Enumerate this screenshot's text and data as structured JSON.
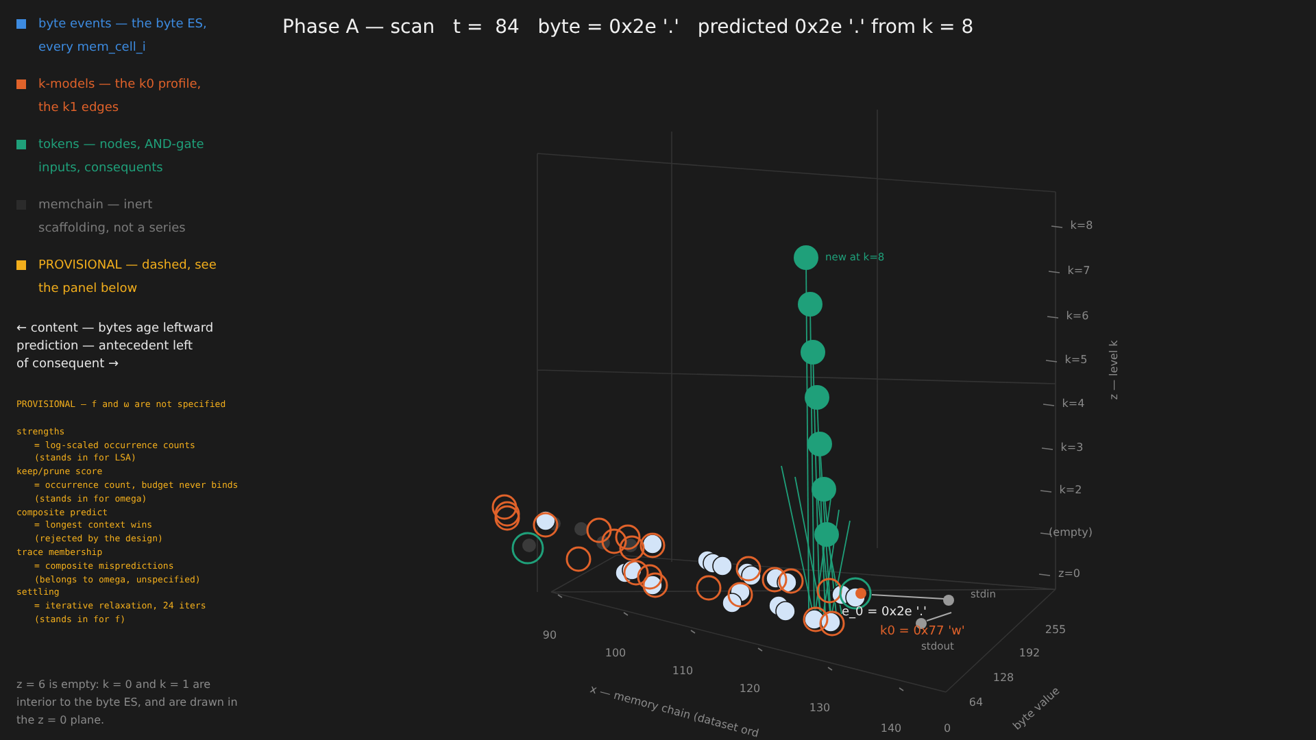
{
  "legend": [
    {
      "label": "byte events — the byte ES, every mem_cell_i",
      "color": "#3d8be0"
    },
    {
      "label": "k-models — the k0 profile, the k1 edges",
      "color": "#e0622a"
    },
    {
      "label": "tokens — nodes, AND-gate inputs, consequents",
      "color": "#1fa07a"
    },
    {
      "label": "memchain — inert scaffolding, not a series",
      "color": "#2b2b2b"
    },
    {
      "label": "PROVISIONAL — dashed, see the panel below",
      "color": "#f2ae1c"
    }
  ],
  "direction_note": "←  content — bytes age leftward\nprediction — antecedent left\nof consequent  →",
  "provisional_panel": {
    "title": "PROVISIONAL — f and ω are not specified",
    "entries": [
      {
        "term": "strengths",
        "definition": "= log-scaled occurrence counts",
        "note": "(stands in for LSA)"
      },
      {
        "term": "keep/prune score",
        "definition": "= occurrence count, budget never binds",
        "note": "(stands in for omega)"
      },
      {
        "term": "composite predict",
        "definition": "= longest context wins",
        "note": "(rejected by the design)"
      },
      {
        "term": "trace membership",
        "definition": "= composite mispredictions",
        "note": "(belongs to omega, unspecified)"
      },
      {
        "term": "settling",
        "definition": "= iterative relaxation, 24 iters",
        "note": "(stands in for f)"
      }
    ]
  },
  "footnote": "z = 6 is empty: k = 0 and k = 1 are interior to the byte ES, and are drawn in the z = 0 plane.",
  "title": "Phase A — scan   t =  84   byte = 0x2e '.'   predicted 0x2e '.' from k = 8",
  "plot": {
    "z_axis": {
      "title": "z — level k",
      "ticks": [
        "k=8",
        "k=7",
        "k=6",
        "k=5",
        "k=4",
        "k=3",
        "k=2",
        "(empty)",
        "z=0"
      ]
    },
    "x_axis": {
      "title": "x — memory chain (dataset ord",
      "ticks": [
        "90",
        "100",
        "110",
        "120",
        "130",
        "140"
      ]
    },
    "y_axis": {
      "title": "byte value",
      "ticks": [
        "0",
        "64",
        "128",
        "192",
        "255"
      ]
    },
    "annotations": [
      {
        "kind": "token",
        "text": "new at k=8"
      },
      {
        "kind": "io",
        "text": "stdin"
      },
      {
        "kind": "byte",
        "text": "e_0 = 0x2e '.'"
      },
      {
        "kind": "kmodel",
        "text": "k0 = 0x77 'w'"
      },
      {
        "kind": "io",
        "text": "stdout"
      }
    ]
  }
}
